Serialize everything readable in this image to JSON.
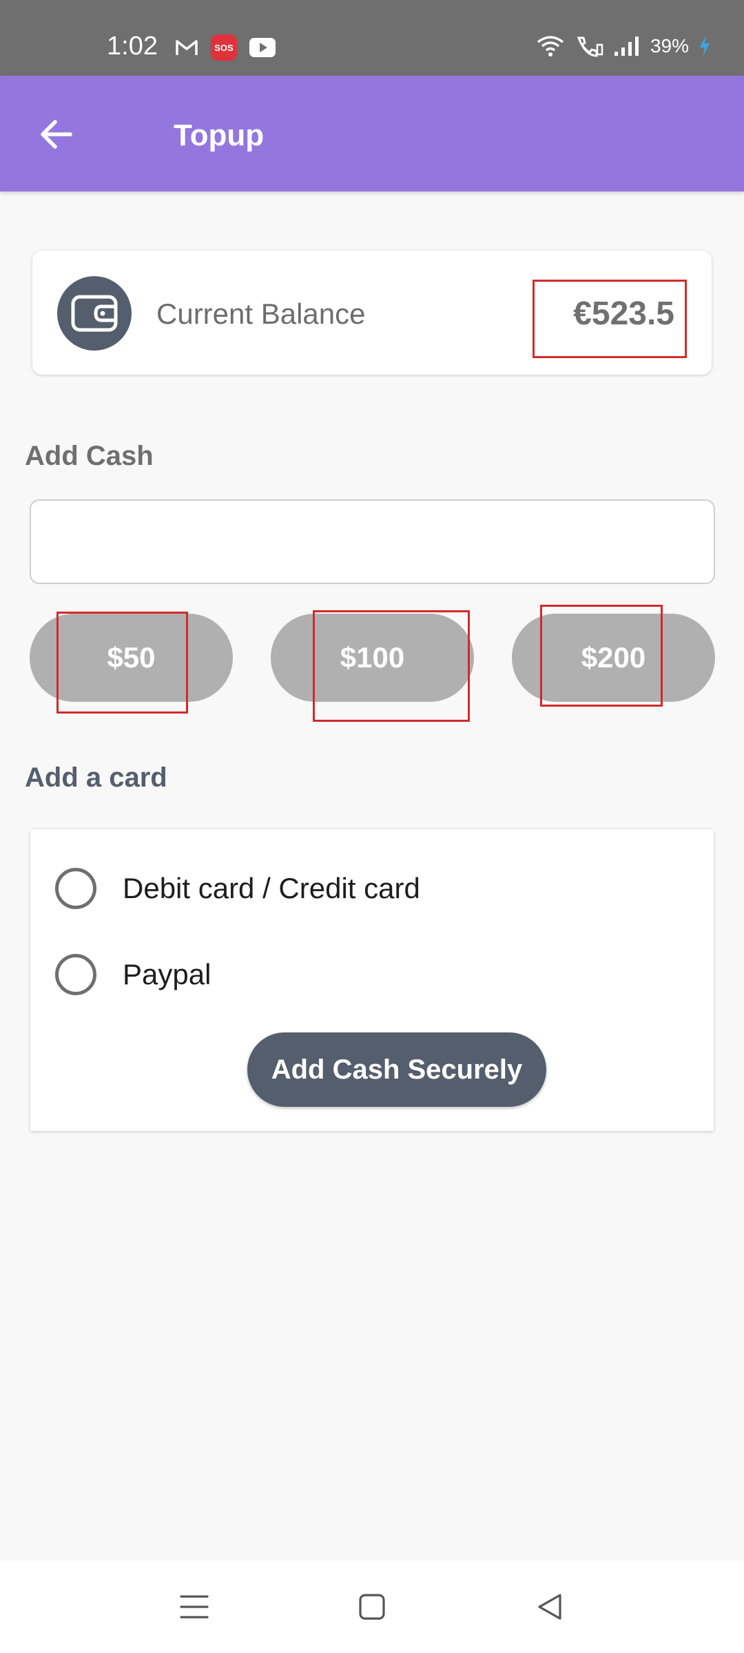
{
  "status_bar": {
    "time": "1:02",
    "sos_label": "SOS",
    "battery": "39%",
    "icons": [
      "gmail-icon",
      "sos-icon",
      "youtube-icon",
      "wifi-icon",
      "wifi-call-icon",
      "signal-icon",
      "battery-charging-icon"
    ]
  },
  "app_bar": {
    "title": "Topup",
    "back_icon": "arrow-left-icon",
    "color": "#9377de"
  },
  "balance": {
    "label": "Current Balance",
    "value": "€523.5",
    "icon": "wallet-icon"
  },
  "add_cash": {
    "title": "Add Cash",
    "input_value": "",
    "amounts": [
      "$50",
      "$100",
      "$200"
    ]
  },
  "add_card": {
    "title": "Add a card",
    "options": [
      "Debit card / Credit card",
      "Paypal"
    ],
    "submit_label": "Add Cash Securely"
  },
  "nav_bar": {
    "icons": [
      "menu-icon",
      "home-square-icon",
      "back-triangle-icon"
    ]
  },
  "colors": {
    "accent": "#9377de",
    "dark": "#555e6d",
    "chip": "#b0b0b0",
    "highlight": "#d22a2a"
  }
}
